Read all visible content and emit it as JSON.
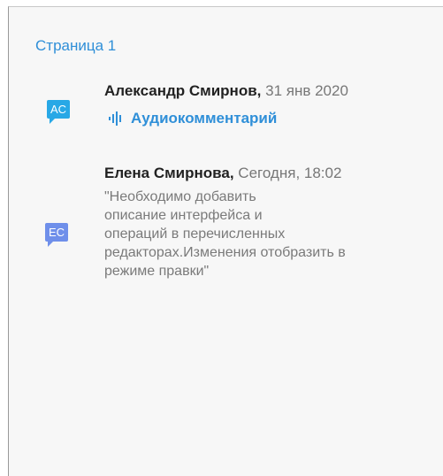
{
  "page_title": "Страница 1",
  "colors": {
    "accent": "#2f8fd8",
    "avatar_ac": "#28a8e6",
    "avatar_ec": "#6f8fea"
  },
  "comments": [
    {
      "initials": "AC",
      "author": "Александр Смирнов,",
      "date": "31 янв 2020",
      "type": "audio",
      "audio_label": "Аудиокомментарий",
      "icon": "audio-wave-icon"
    },
    {
      "initials": "EC",
      "author": "Елена Смирнова,",
      "date": "Сегодня, 18:02",
      "type": "text",
      "text_lines": [
        "\"Необходимо добавить",
        "описание интерфейса и",
        "операций в перечисленных",
        "редакторах.Изменения отобразить в",
        "режиме правки\""
      ]
    }
  ]
}
